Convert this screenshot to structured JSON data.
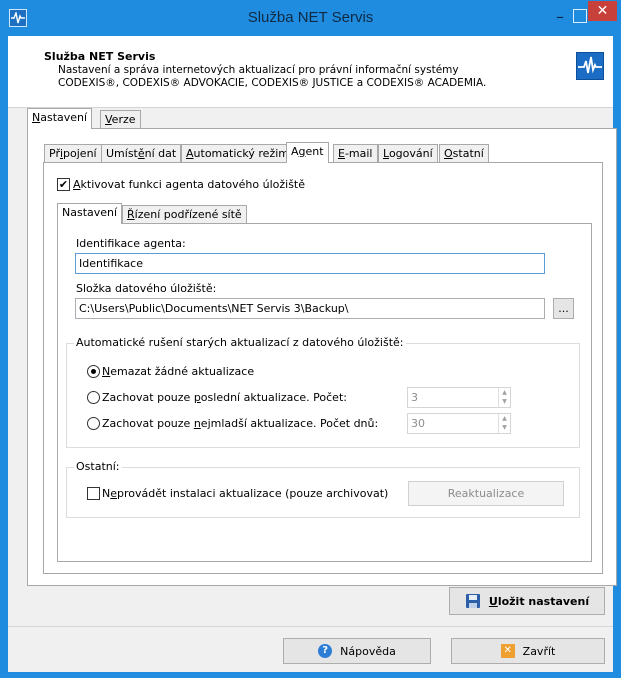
{
  "window": {
    "title": "Služba NET Servis",
    "min_glyph": "–",
    "close_glyph": "✕"
  },
  "header": {
    "title": "Služba NET Servis",
    "desc_line1": "Nastavení a správa internetových aktualizací pro právní informační systémy",
    "desc_line2": "CODEXIS®, CODEXIS® ADVOKACIE, CODEXIS® JUSTICE a CODEXIS® ACADEMIA."
  },
  "top_tabs": {
    "nastaveni": {
      "hot": "N",
      "rest": "astavení"
    },
    "verze": {
      "hot": "V",
      "rest": "erze"
    }
  },
  "sub_tabs": [
    {
      "pre": "Př",
      "hot": "i",
      "post": "pojení"
    },
    {
      "pre": "Umíst",
      "hot": "ě",
      "post": "ní dat"
    },
    {
      "pre": "",
      "hot": "A",
      "post": "utomatický režim"
    },
    {
      "pre": "A",
      "hot": "g",
      "post": "ent"
    },
    {
      "pre": "",
      "hot": "E",
      "post": "-mail"
    },
    {
      "pre": "",
      "hot": "L",
      "post": "ogování"
    },
    {
      "pre": "",
      "hot": "O",
      "post": "statní"
    }
  ],
  "agent": {
    "enable_checked": true,
    "check_glyph": "✔",
    "enable_hot": "A",
    "enable_rest": "ktivovat funkci agenta datového úložiště",
    "inner_tabs": {
      "settings": "Nastavení",
      "network": {
        "hot": "Ř",
        "rest": "ízení podřízené sítě"
      }
    },
    "id_label": "Identifikace agenta:",
    "id_value": "Identifikace",
    "storage_label": "Složka datového úložiště:",
    "storage_value": "C:\\Users\\Public\\Documents\\NET Servis 3\\Backup\\",
    "browse_label": "...",
    "auto_group_label": "Automatické rušení starých aktualizací z datového úložiště:",
    "radio1": {
      "hot": "N",
      "rest": "emazat žádné aktualizace",
      "checked": true
    },
    "radio2": {
      "pre": "Zachovat pouze ",
      "hot": "p",
      "post": "oslední aktualizace. Počet:",
      "value": "3"
    },
    "radio3": {
      "pre": "Zachovat pouze ",
      "hot": "n",
      "post": "ejmladší aktualizace. Počet dnů:",
      "value": "30"
    },
    "spin_up": "▲",
    "spin_down": "▼",
    "other_group_label": "Ostatní:",
    "noinstall": {
      "pre": "N",
      "hot": "e",
      "post": "provádět instalaci aktualizace (pouze archivovat)"
    },
    "reupdate_label": "Reaktualizace"
  },
  "save": {
    "hot": "U",
    "rest": "ložit nastavení"
  },
  "footer": {
    "help_label": "Nápověda",
    "close_label": "Zavřít",
    "help_glyph": "?",
    "close_glyph": "✕"
  },
  "colors": {
    "titlebar": "#1f8ce0",
    "close_button": "#c7403a",
    "accent_blue": "#1a6cc4"
  }
}
